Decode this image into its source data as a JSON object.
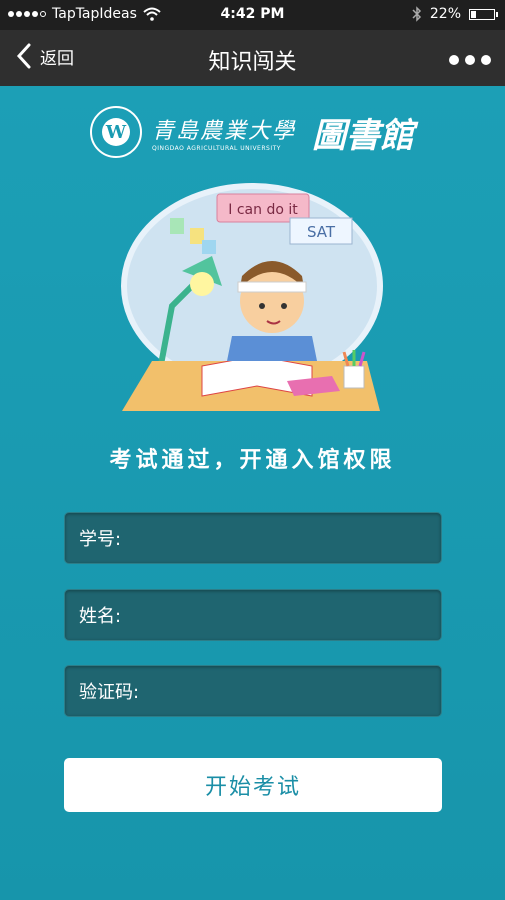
{
  "status_bar": {
    "carrier": "TapTapIdeas",
    "time": "4:42 PM",
    "battery_percent": "22%",
    "battery_level": 0.22,
    "icons": [
      "signal-dots-icon",
      "wifi-icon",
      "bluetooth-icon",
      "battery-icon"
    ]
  },
  "nav": {
    "back_label": "返回",
    "title": "知识闯关",
    "more_icon": "more-dots-icon"
  },
  "header": {
    "school_name_cn": "青島農業大學",
    "school_name_en": "QINGDAO AGRICULTURAL UNIVERSITY",
    "library_label": "圖書館"
  },
  "illustration": {
    "sign_text": "I can do it",
    "book_text": "SAT"
  },
  "slogan": "考试通过，开通入馆权限",
  "form": {
    "student_id_label": "学号:",
    "name_label": "姓名:",
    "captcha_label": "验证码:",
    "student_id_value": "",
    "name_value": "",
    "captcha_value": ""
  },
  "start_button": "开始考试",
  "colors": {
    "accent": "#1a9bb2",
    "navbar": "#2f2f2f",
    "statusbar": "#1f1f1f",
    "field_bg": "#1f6570",
    "button_text": "#1a8ea6"
  }
}
